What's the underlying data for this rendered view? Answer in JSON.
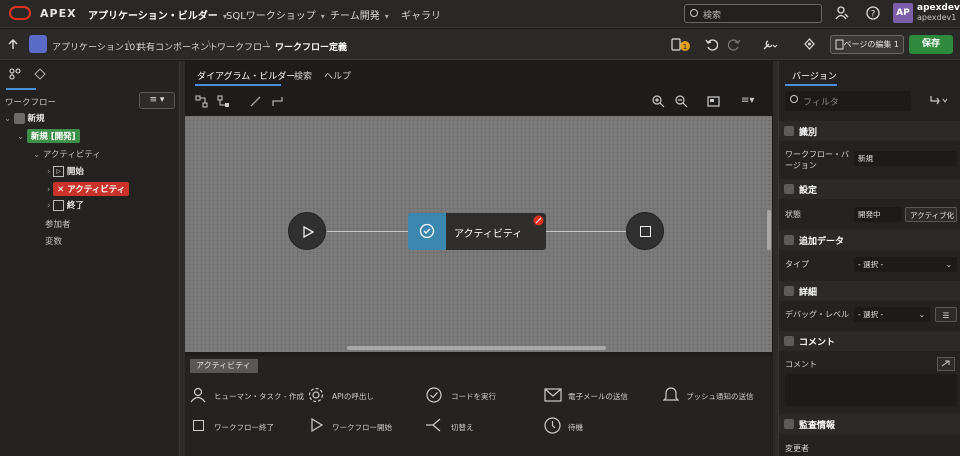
{
  "topbar": {
    "brand": "APEX",
    "nav": [
      "アプリケーション・ビルダー",
      "SQLワークショップ",
      "チーム開発",
      "ギャラリ"
    ],
    "search_placeholder": "検索",
    "avatar_initials": "AP",
    "user_name": "apexdev1",
    "user_workspace": "apexdev1"
  },
  "breadcrumb": {
    "items": [
      "アプリケーション101",
      "共有コンポーネント",
      "ワークフロー",
      "ワークフロー定義"
    ],
    "issues_count": "1",
    "edit_page_label": "ページの編集 1",
    "save_label": "保存"
  },
  "left": {
    "section_title": "ワークフロー",
    "tree": {
      "root": "新規",
      "version": "新規 [開発]",
      "activities_label": "アクティビティ",
      "activities": [
        "開始",
        "アクティビティ",
        "終了"
      ],
      "participants": "参加者",
      "variables": "変数"
    }
  },
  "center": {
    "tabs": [
      "ダイアグラム・ビルダー",
      "検索",
      "ヘルプ"
    ],
    "activity_node_label": "アクティビティ",
    "palette_tab": "アクティビティ",
    "palette": [
      "ヒューマン・タスク - 作成",
      "APIの呼出し",
      "コードを実行",
      "電子メールの送信",
      "プッシュ通知の送信",
      "ワークフロー終了",
      "ワークフロー開始",
      "切替え",
      "待機"
    ]
  },
  "right": {
    "tab": "バージョン",
    "filter_placeholder": "フィルタ",
    "sections": {
      "identification": "識別",
      "settings": "設定",
      "additional_data": "追加データ",
      "advanced": "詳細",
      "comments": "コメント",
      "audit": "監査情報"
    },
    "fields": {
      "version_label": "ワークフロー・バージョン",
      "version_value": "新規",
      "state_label": "状態",
      "state_value": "開発中",
      "activate_button": "アクティブ化",
      "type_label": "タイプ",
      "type_value": "- 選択 -",
      "debug_label": "デバッグ・レベル",
      "debug_value": "- 選択 -",
      "comment_label": "コメント",
      "changed_by_label": "変更者"
    }
  },
  "colors": {
    "accent_blue": "#4c8fd6",
    "save_green": "#2f8a3e",
    "error_red": "#c9332a",
    "activity_blue": "#3b87b0",
    "version_green": "#3f8f4a",
    "apex_red": "#e0311f"
  }
}
